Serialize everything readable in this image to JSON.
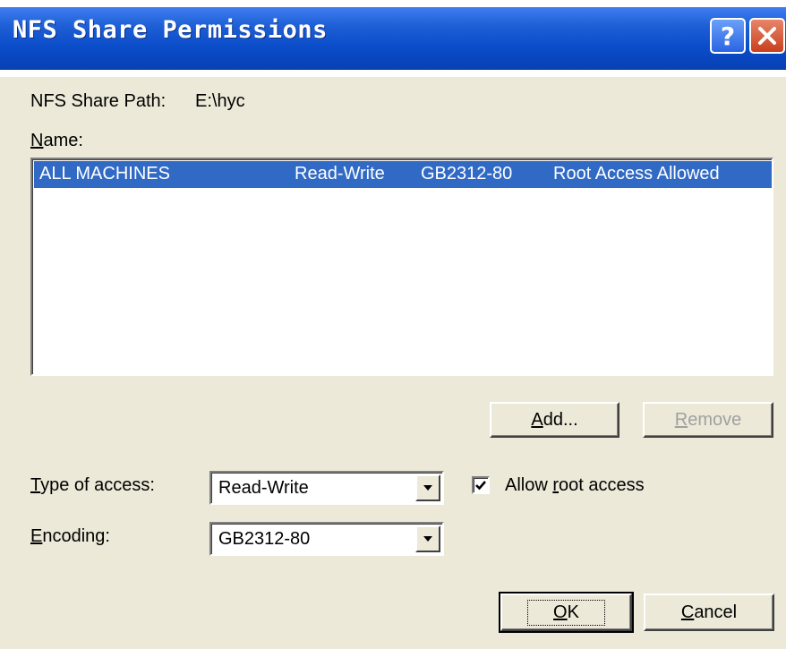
{
  "window": {
    "title": "NFS Share Permissions"
  },
  "titlebar": {
    "help_label": "?",
    "close_icon": "close-icon"
  },
  "share_path": {
    "label": "NFS Share Path:",
    "value": "E:\\hyc"
  },
  "name_list": {
    "label_mnemonic": "N",
    "label_rest": "ame:",
    "rows": [
      {
        "name": "ALL MACHINES",
        "access": "Read-Write",
        "encoding": "GB2312-80",
        "root": "Root Access Allowed"
      }
    ]
  },
  "buttons": {
    "add_mnemonic": "A",
    "add_rest": "dd...",
    "remove_mnemonic": "R",
    "remove_rest": "emove",
    "ok_mnemonic": "O",
    "ok_rest": "K",
    "cancel_mnemonic": "C",
    "cancel_rest": "ancel"
  },
  "type_of_access": {
    "label_mnemonic": "T",
    "label_rest": "ype of access:",
    "value": "Read-Write"
  },
  "encoding": {
    "label_mnemonic": "E",
    "label_rest": "ncoding:",
    "value": "GB2312-80"
  },
  "allow_root": {
    "label_pre": "Allow ",
    "label_mnemonic": "r",
    "label_rest": "oot access",
    "checked": true
  },
  "colors": {
    "titlebar": "#0a4cc9",
    "selection": "#316ac5",
    "dialog_bg": "#ece9d8"
  }
}
